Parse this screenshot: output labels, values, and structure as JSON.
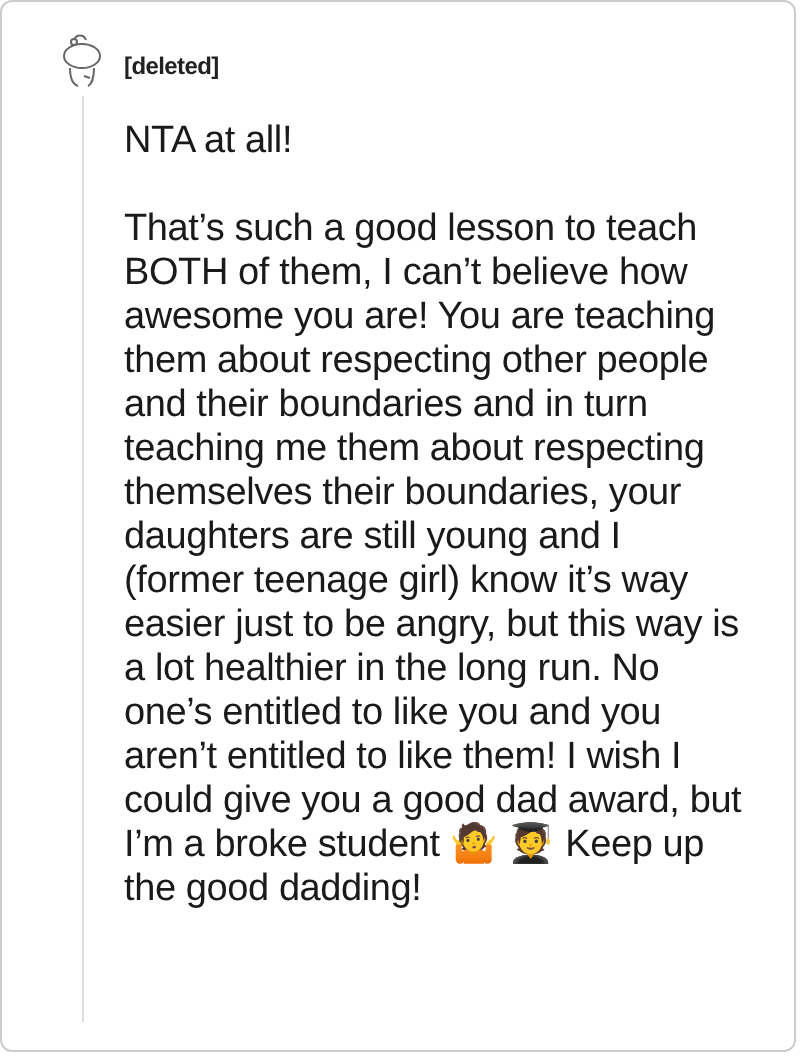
{
  "comment": {
    "author": "[deleted]",
    "paragraphs": [
      "NTA at all!",
      "That’s such a good lesson to teach BOTH of them, I can’t believe how awesome you are! You are teaching them about respecting other people and their boundaries and in turn teaching me them about respecting themselves their boundaries, your daughters are still young and I (former teenage girl) know it’s way easier just to be angry, but this way is a lot healthier in the long run. No one’s entitled to like you and you aren’t entitled to like them! I wish I could give you a good dad award, but I’m a broke student 🤷 🧑‍🎓 Keep up the good dadding!"
    ]
  }
}
